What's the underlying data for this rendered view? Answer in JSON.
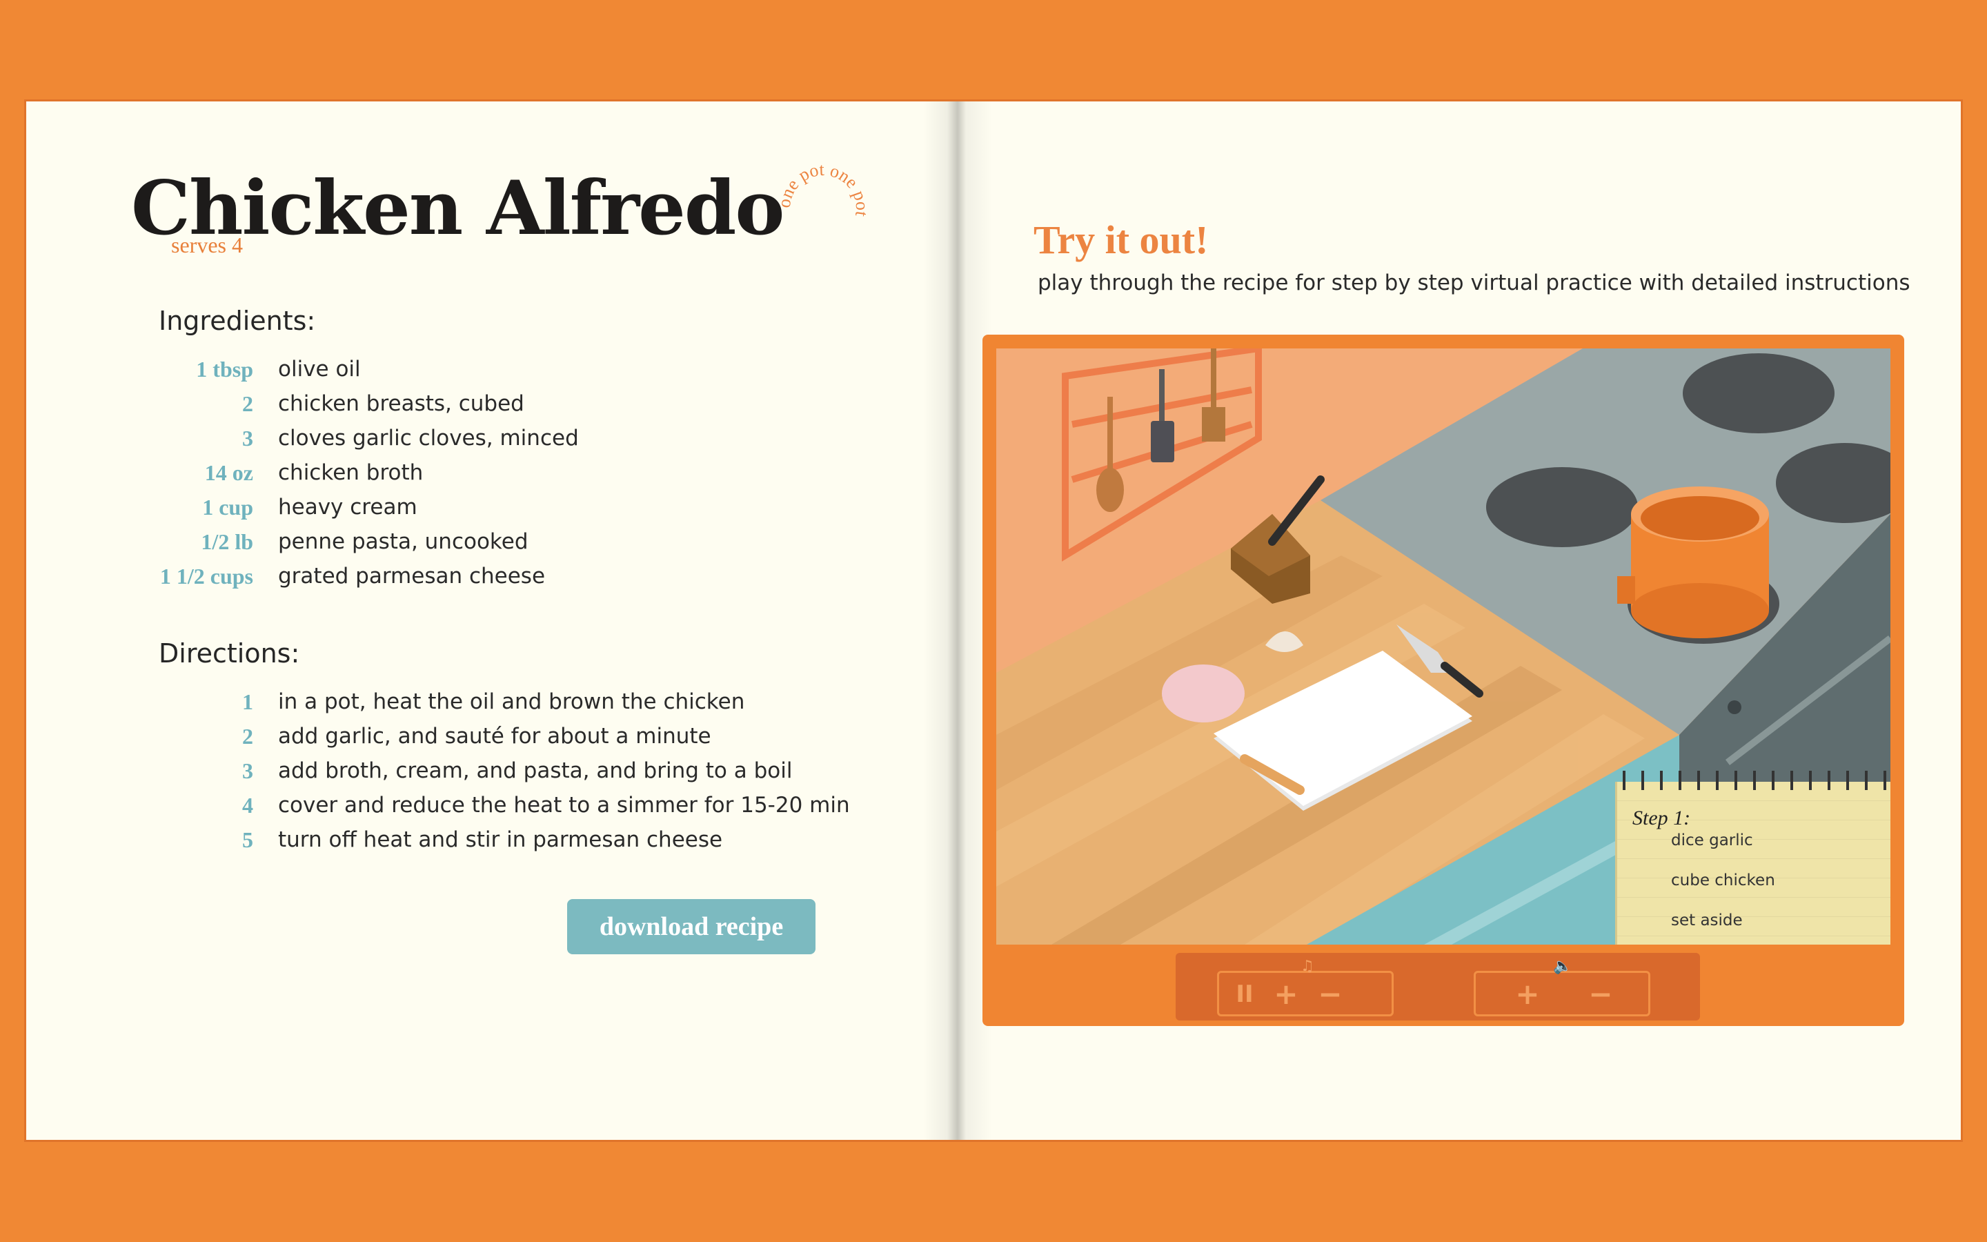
{
  "recipe": {
    "title": "Chicken Alfredo",
    "badge": "one pot one pot",
    "serves": "serves 4",
    "ingredients_heading": "Ingredients:",
    "ingredients": [
      {
        "qty": "1 tbsp",
        "item": "olive oil"
      },
      {
        "qty": "2",
        "item": "chicken breasts, cubed"
      },
      {
        "qty": "3",
        "item": "cloves garlic cloves, minced"
      },
      {
        "qty": "14 oz",
        "item": "chicken broth"
      },
      {
        "qty": "1 cup",
        "item": "heavy cream"
      },
      {
        "qty": "1/2 lb",
        "item": "penne pasta, uncooked"
      },
      {
        "qty": "1 1/2 cups",
        "item": "grated parmesan cheese"
      }
    ],
    "directions_heading": "Directions:",
    "directions": [
      {
        "num": "1",
        "text": "in a pot, heat the oil and brown the chicken"
      },
      {
        "num": "2",
        "text": "add garlic, and sauté for about a minute"
      },
      {
        "num": "3",
        "text": "add broth, cream, and pasta, and bring to a boil"
      },
      {
        "num": "4",
        "text": "cover and reduce the heat to a simmer for 15-20 min"
      },
      {
        "num": "5",
        "text": "turn off heat and stir in parmesan cheese"
      }
    ],
    "download_label": "download recipe"
  },
  "practice": {
    "title": "Try it out!",
    "subtitle": "play through the recipe for step by step virtual practice with detailed instructions",
    "notepad": {
      "step_label": "Step 1:",
      "items": [
        "dice garlic",
        "cube chicken",
        "set aside"
      ]
    },
    "controls": {
      "music_icon": "music-note-icon",
      "volume_icon": "speaker-icon",
      "pause": "II",
      "plus": "+",
      "minus": "−"
    }
  },
  "colors": {
    "background": "#f08834",
    "page": "#fefdf1",
    "accent_orange": "#ec8441",
    "accent_teal": "#6fb2bd",
    "button_teal": "#7cbac0"
  }
}
